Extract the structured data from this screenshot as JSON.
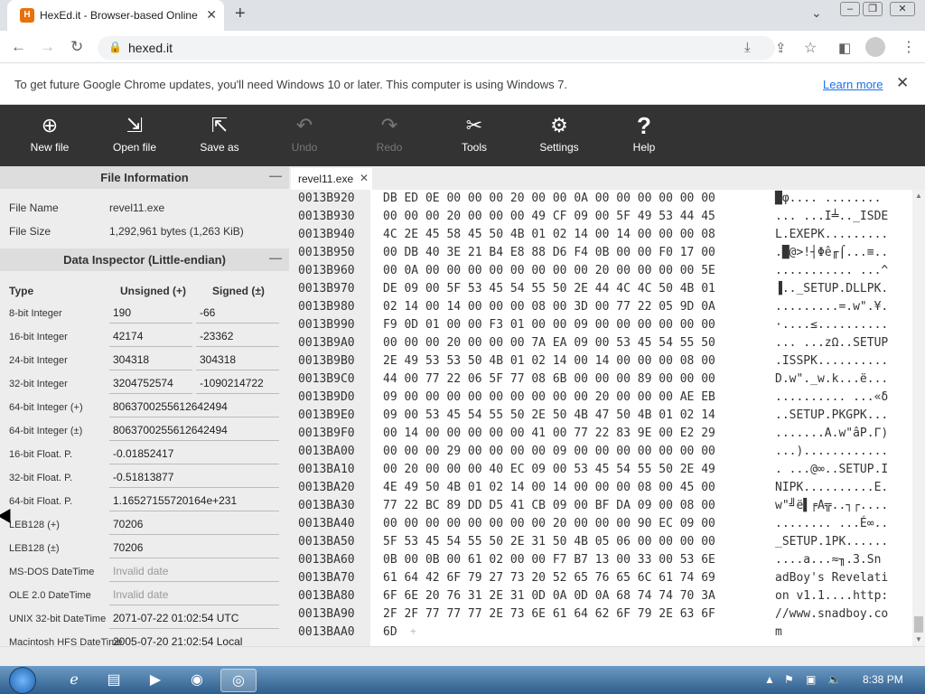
{
  "browser": {
    "tab_title": "HexEd.it - Browser-based Online",
    "url": "hexed.it",
    "infobar_message": "To get future Google Chrome updates, you'll need Windows 10 or later. This computer is using Windows 7.",
    "learn_more": "Learn more"
  },
  "toolbar": {
    "items": [
      {
        "label": "New file",
        "icon": "new-file-icon",
        "enabled": true
      },
      {
        "label": "Open file",
        "icon": "open-file-icon",
        "enabled": true
      },
      {
        "label": "Save as",
        "icon": "save-as-icon",
        "enabled": true
      },
      {
        "label": "Undo",
        "icon": "undo-icon",
        "enabled": false
      },
      {
        "label": "Redo",
        "icon": "redo-icon",
        "enabled": false
      },
      {
        "label": "Tools",
        "icon": "tools-icon",
        "enabled": true
      },
      {
        "label": "Settings",
        "icon": "gear-icon",
        "enabled": true
      },
      {
        "label": "Help",
        "icon": "help-icon",
        "enabled": true
      }
    ]
  },
  "file_info": {
    "header": "File Information",
    "file_name_label": "File Name",
    "file_name": "revel11.exe",
    "file_size_label": "File Size",
    "file_size": "1,292,961 bytes (1,263 KiB)"
  },
  "inspector": {
    "header": "Data Inspector (Little-endian)",
    "col_type": "Type",
    "col_unsigned": "Unsigned (+)",
    "col_signed": "Signed (±)",
    "rows": [
      {
        "name": "8-bit Integer",
        "unsigned": "190",
        "signed": "-66"
      },
      {
        "name": "16-bit Integer",
        "unsigned": "42174",
        "signed": "-23362"
      },
      {
        "name": "24-bit Integer",
        "unsigned": "304318",
        "signed": "304318"
      },
      {
        "name": "32-bit Integer",
        "unsigned": "3204752574",
        "signed": "-1090214722"
      }
    ],
    "wide_rows": [
      {
        "name": "64-bit Integer (+)",
        "value": "8063700255612642494",
        "invalid": false
      },
      {
        "name": "64-bit Integer (±)",
        "value": "8063700255612642494",
        "invalid": false
      },
      {
        "name": "16-bit Float. P.",
        "value": "-0.01852417",
        "invalid": false
      },
      {
        "name": "32-bit Float. P.",
        "value": "-0.51813877",
        "invalid": false
      },
      {
        "name": "64-bit Float. P.",
        "value": "1.16527155720164e+231",
        "invalid": false
      },
      {
        "name": "LEB128 (+)",
        "value": "70206",
        "invalid": false
      },
      {
        "name": "LEB128 (±)",
        "value": "70206",
        "invalid": false
      },
      {
        "name": "MS-DOS DateTime",
        "value": "Invalid date",
        "invalid": true
      },
      {
        "name": "OLE 2.0 DateTime",
        "value": "Invalid date",
        "invalid": true
      },
      {
        "name": "UNIX 32-bit DateTime",
        "value": "2071-07-22 01:02:54 UTC",
        "invalid": false
      },
      {
        "name": "Macintosh HFS DateTime",
        "value": "2005-07-20 21:02:54 Local",
        "invalid": false
      }
    ]
  },
  "editor": {
    "tab_name": "revel11.exe",
    "rows": [
      {
        "offset": "0013B920",
        "hex": "DB ED 0E 00 00 00 20 00 00 0A 00 00 00 00 00 00",
        "ascii": "█φ.... ........"
      },
      {
        "offset": "0013B930",
        "hex": "00 00 00 20 00 00 00 49 CF 09 00 5F 49 53 44 45",
        "ascii": "... ...I╧.._ISDE"
      },
      {
        "offset": "0013B940",
        "hex": "4C 2E 45 58 45 50 4B 01 02 14 00 14 00 00 00 08",
        "ascii": "L.EXEPK........."
      },
      {
        "offset": "0013B950",
        "hex": "00 DB 40 3E 21 B4 E8 88 D6 F4 0B 00 00 F0 17 00",
        "ascii": ".█@>!┤Φê╓⌠...≡.."
      },
      {
        "offset": "0013B960",
        "hex": "00 0A 00 00 00 00 00 00 00 00 20 00 00 00 00 5E",
        "ascii": "........... ...^"
      },
      {
        "offset": "0013B970",
        "hex": "DE 09 00 5F 53 45 54 55 50 2E 44 4C 4C 50 4B 01",
        "ascii": "▐.._SETUP.DLLPK."
      },
      {
        "offset": "0013B980",
        "hex": "02 14 00 14 00 00 00 08 00 3D 00 77 22 05 9D 0A",
        "ascii": ".........=.w\".¥."
      },
      {
        "offset": "0013B990",
        "hex": "F9 0D 01 00 00 F3 01 00 00 09 00 00 00 00 00 00",
        "ascii": "·....≤.........."
      },
      {
        "offset": "0013B9A0",
        "hex": "00 00 00 20 00 00 00 7A EA 09 00 53 45 54 55 50",
        "ascii": "... ...zΩ..SETUP"
      },
      {
        "offset": "0013B9B0",
        "hex": "2E 49 53 53 50 4B 01 02 14 00 14 00 00 00 08 00",
        "ascii": ".ISSPK.........."
      },
      {
        "offset": "0013B9C0",
        "hex": "44 00 77 22 06 5F 77 08 6B 00 00 00 89 00 00 00",
        "ascii": "D.w\"._w.k...ë..."
      },
      {
        "offset": "0013B9D0",
        "hex": "09 00 00 00 00 00 00 00 00 00 20 00 00 00 AE EB",
        "ascii": ".......... ...«δ"
      },
      {
        "offset": "0013B9E0",
        "hex": "09 00 53 45 54 55 50 2E 50 4B 47 50 4B 01 02 14",
        "ascii": "..SETUP.PKGPK..."
      },
      {
        "offset": "0013B9F0",
        "hex": "00 14 00 00 00 00 00 41 00 77 22 83 9E 00 E2 29",
        "ascii": ".......A.w\"âP.Γ)"
      },
      {
        "offset": "0013BA00",
        "hex": "00 00 00 29 00 00 00 00 09 00 00 00 00 00 00 00",
        "ascii": "...)............"
      },
      {
        "offset": "0013BA10",
        "hex": "00 20 00 00 00 40 EC 09 00 53 45 54 55 50 2E 49",
        "ascii": ". ...@∞..SETUP.I"
      },
      {
        "offset": "0013BA20",
        "hex": "4E 49 50 4B 01 02 14 00 14 00 00 00 08 00 45 00",
        "ascii": "NIPK..........E."
      },
      {
        "offset": "0013BA30",
        "hex": "77 22 BC 89 DD D5 41 CB 09 00 BF DA 09 00 08 00",
        "ascii": "w\"╝ë▌╒A╦..┐┌...."
      },
      {
        "offset": "0013BA40",
        "hex": "00 00 00 00 00 00 00 00 20 00 00 00 90 EC 09 00",
        "ascii": "........ ...É∞.."
      },
      {
        "offset": "0013BA50",
        "hex": "5F 53 45 54 55 50 2E 31 50 4B 05 06 00 00 00 00",
        "ascii": "_SETUP.1PK......"
      },
      {
        "offset": "0013BA60",
        "hex": "0B 00 0B 00 61 02 00 00 F7 B7 13 00 33 00 53 6E",
        "ascii": "....a...≈╖.3.Sn"
      },
      {
        "offset": "0013BA70",
        "hex": "61 64 42 6F 79 27 73 20 52 65 76 65 6C 61 74 69",
        "ascii": "adBoy's Revelati"
      },
      {
        "offset": "0013BA80",
        "hex": "6F 6E 20 76 31 2E 31 0D 0A 0D 0A 68 74 74 70 3A",
        "ascii": "on v1.1....http:"
      },
      {
        "offset": "0013BA90",
        "hex": "2F 2F 77 77 77 2E 73 6E 61 64 62 6F 79 2E 63 6F",
        "ascii": "//www.snadboy.co"
      },
      {
        "offset": "0013BAA0",
        "hex": "6D",
        "ascii": "m"
      }
    ],
    "append_symbol": "+"
  },
  "taskbar": {
    "clock": "8:38 PM"
  }
}
